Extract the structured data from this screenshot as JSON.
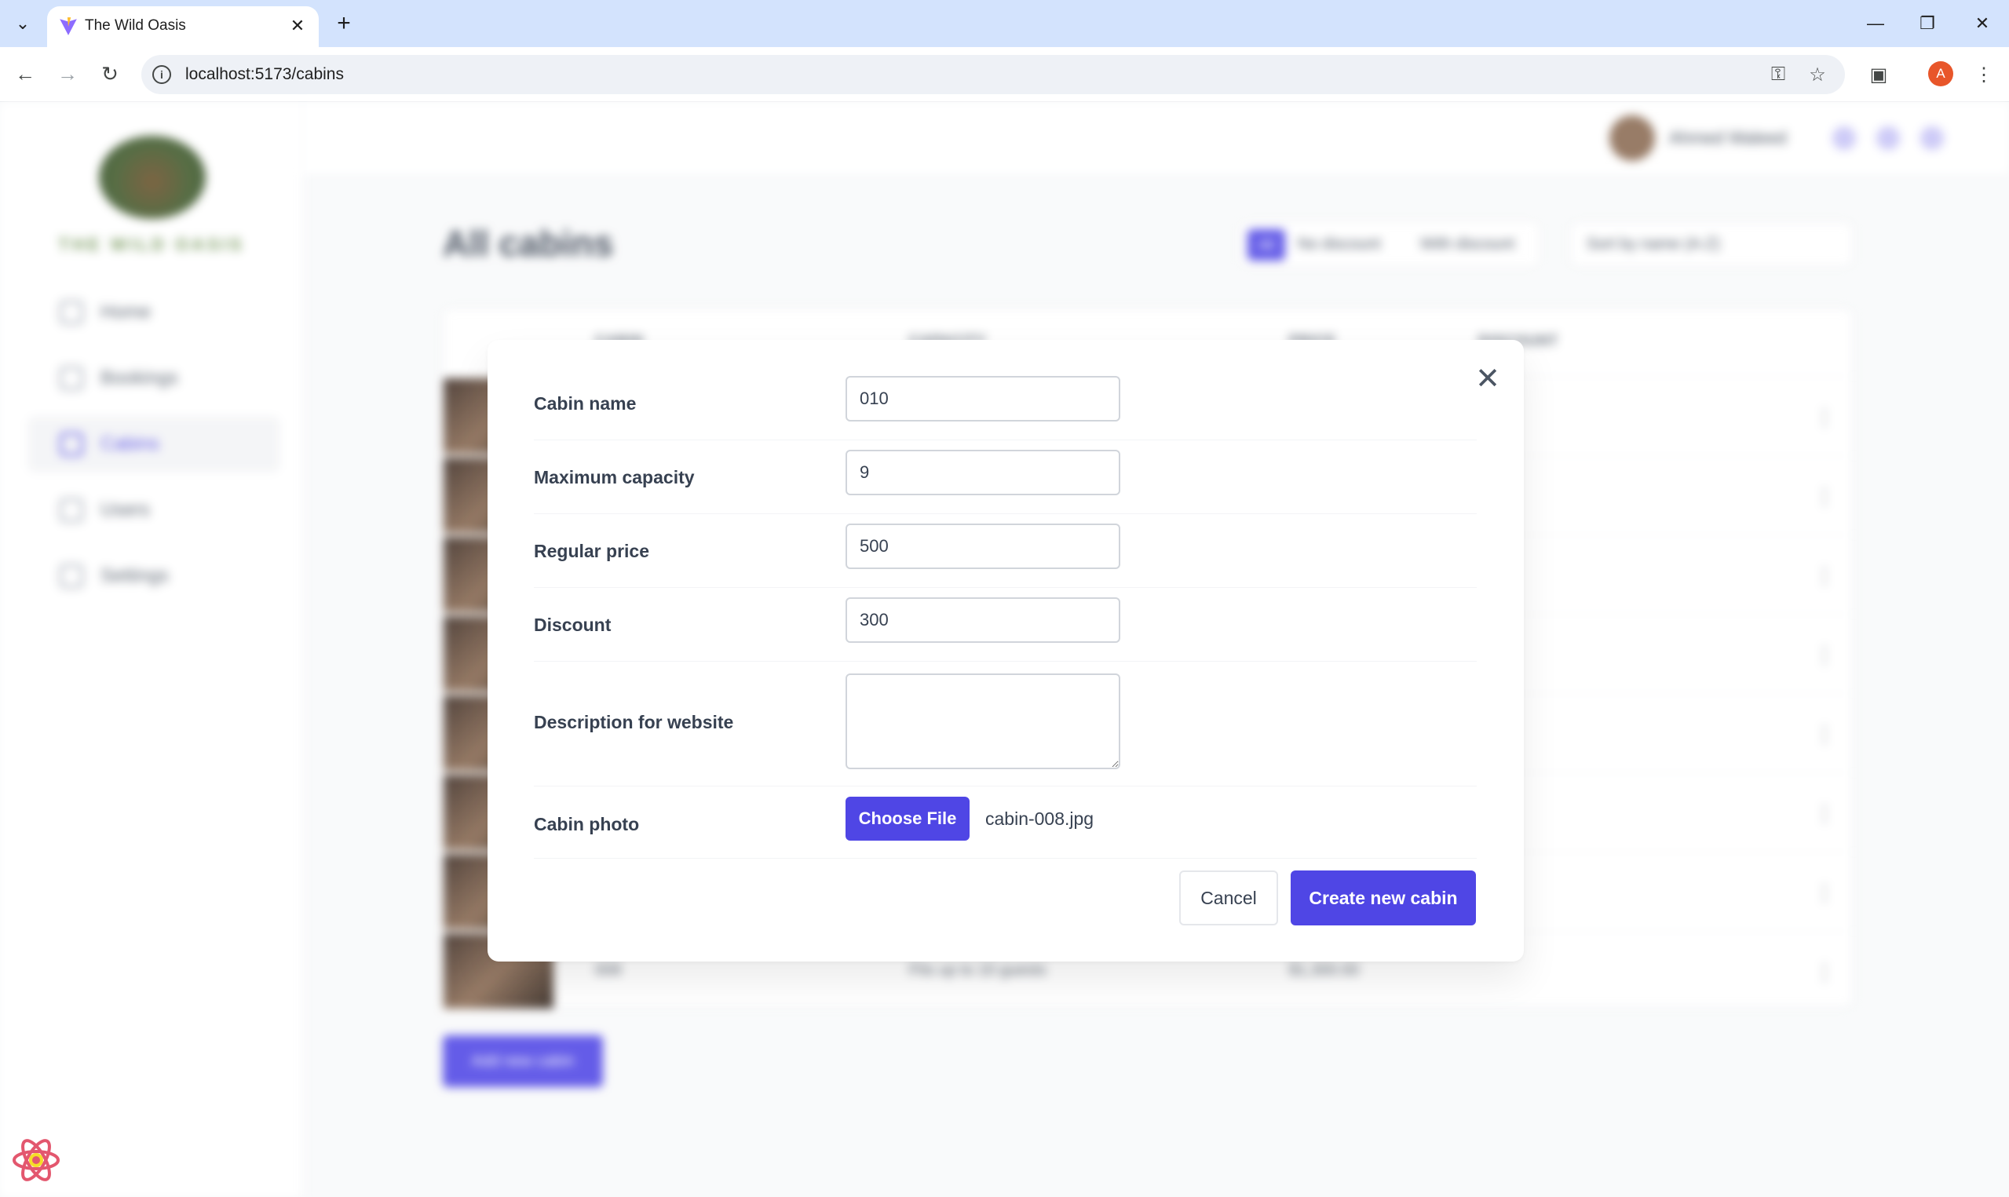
{
  "browser": {
    "tab_title": "The Wild Oasis",
    "url": "localhost:5173/cabins",
    "profile_initial": "A"
  },
  "sidebar": {
    "logo_text": "THE WILD OASIS",
    "items": [
      {
        "label": "Home",
        "icon": "home-icon"
      },
      {
        "label": "Bookings",
        "icon": "calendar-icon"
      },
      {
        "label": "Cabins",
        "icon": "cabin-icon",
        "active": true
      },
      {
        "label": "Users",
        "icon": "users-icon"
      },
      {
        "label": "Settings",
        "icon": "settings-icon"
      }
    ]
  },
  "header": {
    "user_name": "Ahmed Waleed"
  },
  "main": {
    "title": "All cabins",
    "filters": [
      "All",
      "No discount",
      "With discount"
    ],
    "sort_label": "Sort by name (A-Z)",
    "table_headers": [
      "CABIN",
      "CAPACITY",
      "PRICE",
      "DISCOUNT"
    ],
    "last_row": {
      "cabin": "008",
      "capacity": "Fits up to 10 guests",
      "price": "$1,300.00"
    },
    "add_button": "Add new cabin"
  },
  "modal": {
    "fields": {
      "cabin_name": {
        "label": "Cabin name",
        "value": "010"
      },
      "max_capacity": {
        "label": "Maximum capacity",
        "value": "9"
      },
      "regular_price": {
        "label": "Regular price",
        "value": "500"
      },
      "discount": {
        "label": "Discount",
        "value": "300"
      },
      "description": {
        "label": "Description for website",
        "value": ""
      },
      "photo": {
        "label": "Cabin photo",
        "button": "Choose File",
        "file_name": "cabin-008.jpg"
      }
    },
    "cancel_label": "Cancel",
    "submit_label": "Create new cabin"
  },
  "colors": {
    "brand": "#4f46e5",
    "text": "#374151",
    "border": "#d1d5db"
  }
}
